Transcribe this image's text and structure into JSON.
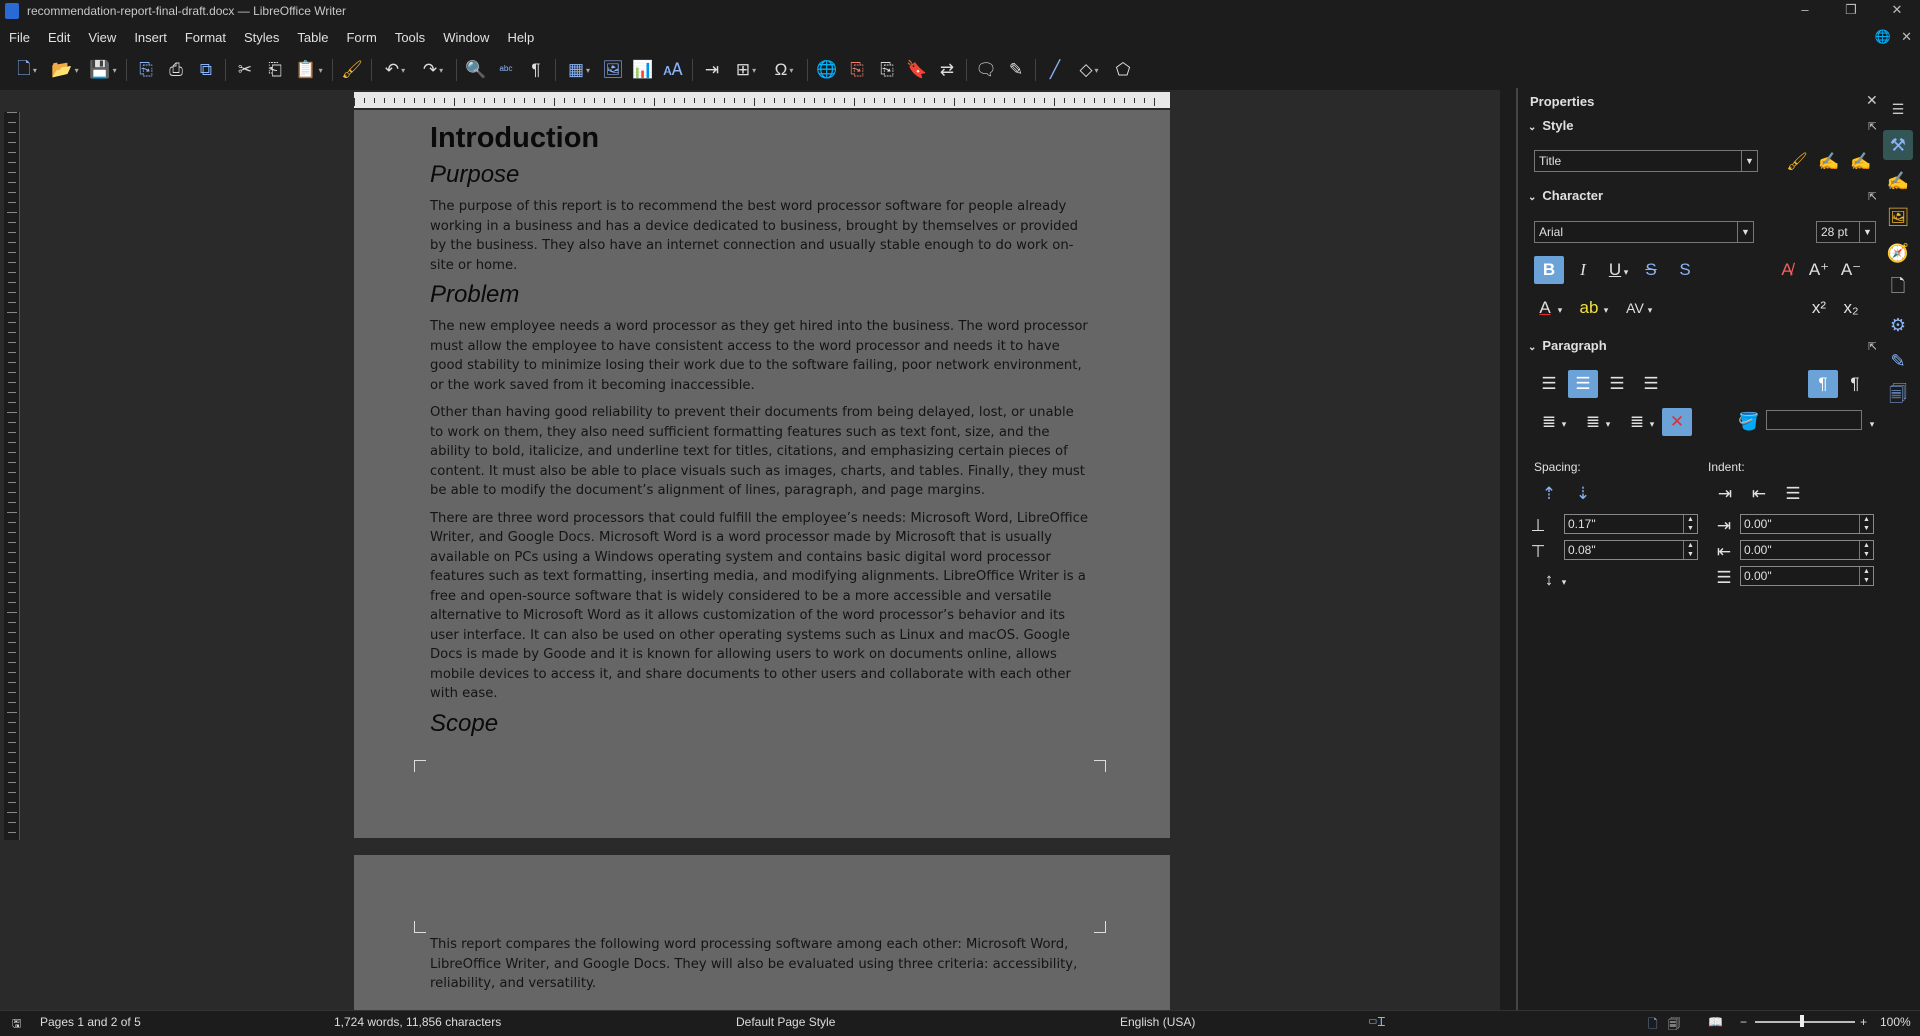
{
  "window": {
    "title": "recommendation-report-final-draft.docx — LibreOffice Writer",
    "controls": [
      "–",
      "❐",
      "✕"
    ]
  },
  "menu": [
    "File",
    "Edit",
    "View",
    "Insert",
    "Format",
    "Styles",
    "Table",
    "Form",
    "Tools",
    "Window",
    "Help"
  ],
  "toolbar": {
    "icons": [
      "new-icon",
      "open-icon",
      "save-icon",
      "export-pdf-icon",
      "print-icon",
      "print-preview-icon",
      "cut-icon",
      "copy-icon",
      "paste-icon",
      "clone-formatting-icon",
      "undo-icon",
      "redo-icon",
      "find-replace-icon",
      "spelling-icon",
      "formatting-marks-icon",
      "insert-table-icon",
      "insert-image-icon",
      "insert-chart-icon",
      "insert-textbox-icon",
      "page-break-icon",
      "insert-field-icon",
      "special-character-icon",
      "hyperlink-icon",
      "footnote-icon",
      "endnote-icon",
      "bookmark-icon",
      "cross-reference-icon",
      "comment-icon",
      "track-changes-icon",
      "line-icon",
      "basic-shapes-icon",
      "draw-functions-icon"
    ]
  },
  "document": {
    "page1": {
      "heading1": "Introduction",
      "purpose_heading": "Purpose",
      "purpose_text": "The purpose of this report is to recommend the best word processor software for people already working in a business and has a device dedicated to business, brought by themselves or provided by the business. They also have an internet connection and usually stable enough to do work on-site or home.",
      "problem_heading": "Problem",
      "problem_p1": "The new employee needs a word processor as they get hired into the business. The word processor must allow the employee to have consistent access to the word processor and needs it to have good stability to minimize losing their work due to the software failing, poor network environment, or the work saved from it becoming inaccessible.",
      "problem_p2": "Other than having good reliability to prevent their documents from being delayed, lost, or unable to work on them, they also need sufficient formatting features such as text font, size, and the ability to bold, italicize, and underline text for titles, citations, and emphasizing certain pieces of content. It must also be able to place visuals such as images, charts, and tables. Finally, they must be able to modify the document’s alignment of lines, paragraph, and page margins.",
      "problem_p3": "There are three word processors that could fulfill the employee’s needs: Microsoft Word, LibreOffice Writer, and Google Docs. Microsoft Word is a word processor made by Microsoft that is usually available on PCs using a Windows operating system and contains basic digital word processor features such as text formatting, inserting media, and modifying alignments. LibreOffice Writer is a free and open-source software that is widely considered to be a more accessible and versatile alternative to Microsoft Word as it allows customization of the word processor’s behavior and its user interface. It can also be used on other operating systems such as Linux and macOS. Google Docs is made by Goode and it is known for allowing users to work on documents online, allows mobile devices to access it, and share documents to other users and collaborate with each other with ease.",
      "scope_heading": "Scope"
    },
    "page2": {
      "scope_text": "This report compares the following word processing software among each other: Microsoft Word, LibreOffice Writer, and Google Docs. They will also be evaluated using three criteria: accessibility, reliability, and versatility."
    }
  },
  "sidebar": {
    "title": "Properties",
    "style_section": "Style",
    "style_value": "Title",
    "character_section": "Character",
    "font_name": "Arial",
    "font_size": "28 pt",
    "paragraph_section": "Paragraph",
    "spacing_label": "Spacing:",
    "indent_label": "Indent:",
    "above_spacing": "0.17\"",
    "below_spacing": "0.08\"",
    "indent_before": "0.00\"",
    "indent_after": "0.00\"",
    "first_line_indent": "0.00\"",
    "bold_active": true,
    "center_align_active": true
  },
  "statusbar": {
    "pages": "Pages 1 and 2 of 5",
    "words": "1,724 words, 11,856 characters",
    "page_style": "Default Page Style",
    "language": "English (USA)",
    "zoom": "100%"
  },
  "colors": {
    "page_bg": "#666666",
    "accent": "#6ba3d8",
    "icon_blue": "#8ab4f8"
  }
}
